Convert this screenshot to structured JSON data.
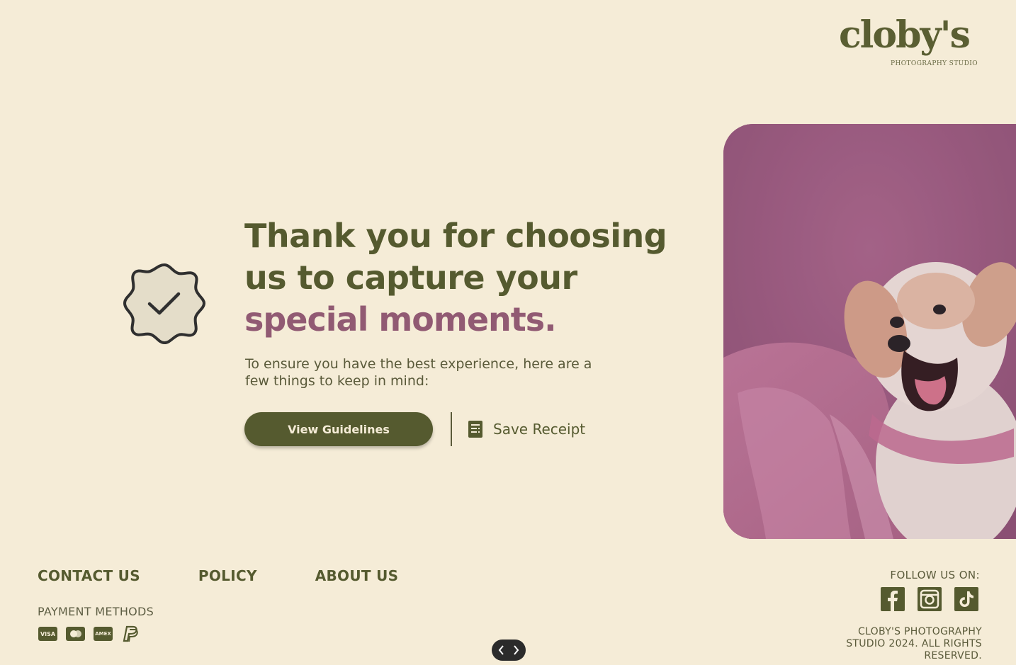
{
  "brand": {
    "logo_text": "cloby's",
    "logo_subtitle": "PHOTOGRAPHY STUDIO"
  },
  "hero": {
    "headline_line1": "Thank you for choosing",
    "headline_line2": "us to capture your",
    "headline_accent": "special moments.",
    "subtext": "To ensure you have the best experience, here are a few things to keep in mind:",
    "primary_button": "View Guidelines",
    "secondary_button": "Save Receipt",
    "badge_icon": "check-badge-icon",
    "photo_alt": "dog-photo"
  },
  "footer": {
    "links": [
      "CONTACT US",
      "POLICY",
      "ABOUT US"
    ],
    "payment_label": "PAYMENT METHODS",
    "payment_methods": [
      "VISA",
      "mastercard",
      "AMEX",
      "PayPal"
    ],
    "follow_label": "FOLLOW US ON:",
    "social": [
      "facebook-icon",
      "instagram-icon",
      "tiktok-icon"
    ],
    "copyright": "CLOBY'S PHOTOGRAPHY STUDIO 2024. ALL RIGHTS RESERVED."
  },
  "colors": {
    "background": "#f5ecd7",
    "primary": "#555a2f",
    "accent": "#915a73"
  }
}
